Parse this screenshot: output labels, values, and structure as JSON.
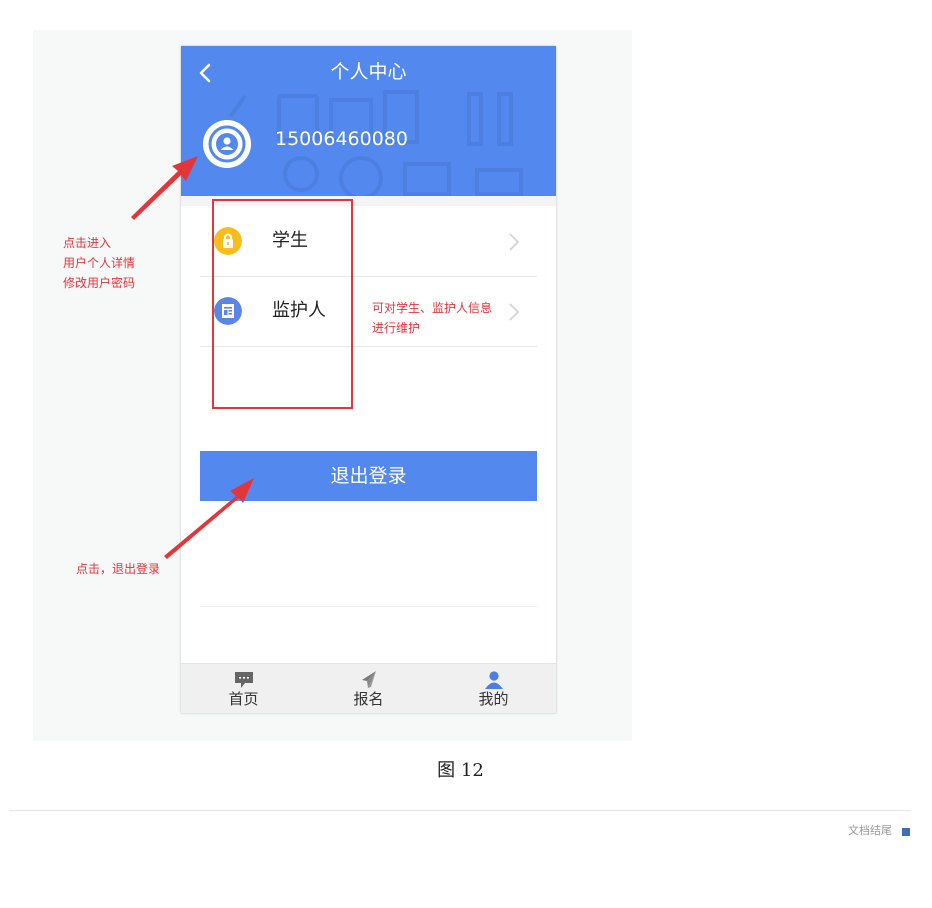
{
  "phone": {
    "header": {
      "title": "个人中心",
      "phone_number": "15006460080"
    },
    "menu": [
      {
        "label": "学生",
        "icon": "lock-icon",
        "icon_color": "#f7be19"
      },
      {
        "label": "监护人",
        "icon": "document-icon",
        "icon_color": "#5a86e6"
      }
    ],
    "logout_label": "退出登录",
    "tabs": [
      {
        "label": "首页",
        "icon": "chat-icon"
      },
      {
        "label": "报名",
        "icon": "send-icon"
      },
      {
        "label": "我的",
        "icon": "user-icon"
      }
    ]
  },
  "annotations": {
    "profile_note": [
      "点击进入",
      "用户个人详情",
      "修改用户密码"
    ],
    "menu_note": [
      "可对学生、监护人信息",
      "进行维护"
    ],
    "logout_note": "点击，退出登录"
  },
  "caption": "图 12",
  "footer": {
    "doc_end": "文档结尾"
  },
  "colors": {
    "primary": "#5389ef",
    "annotation": "#e3363b"
  }
}
